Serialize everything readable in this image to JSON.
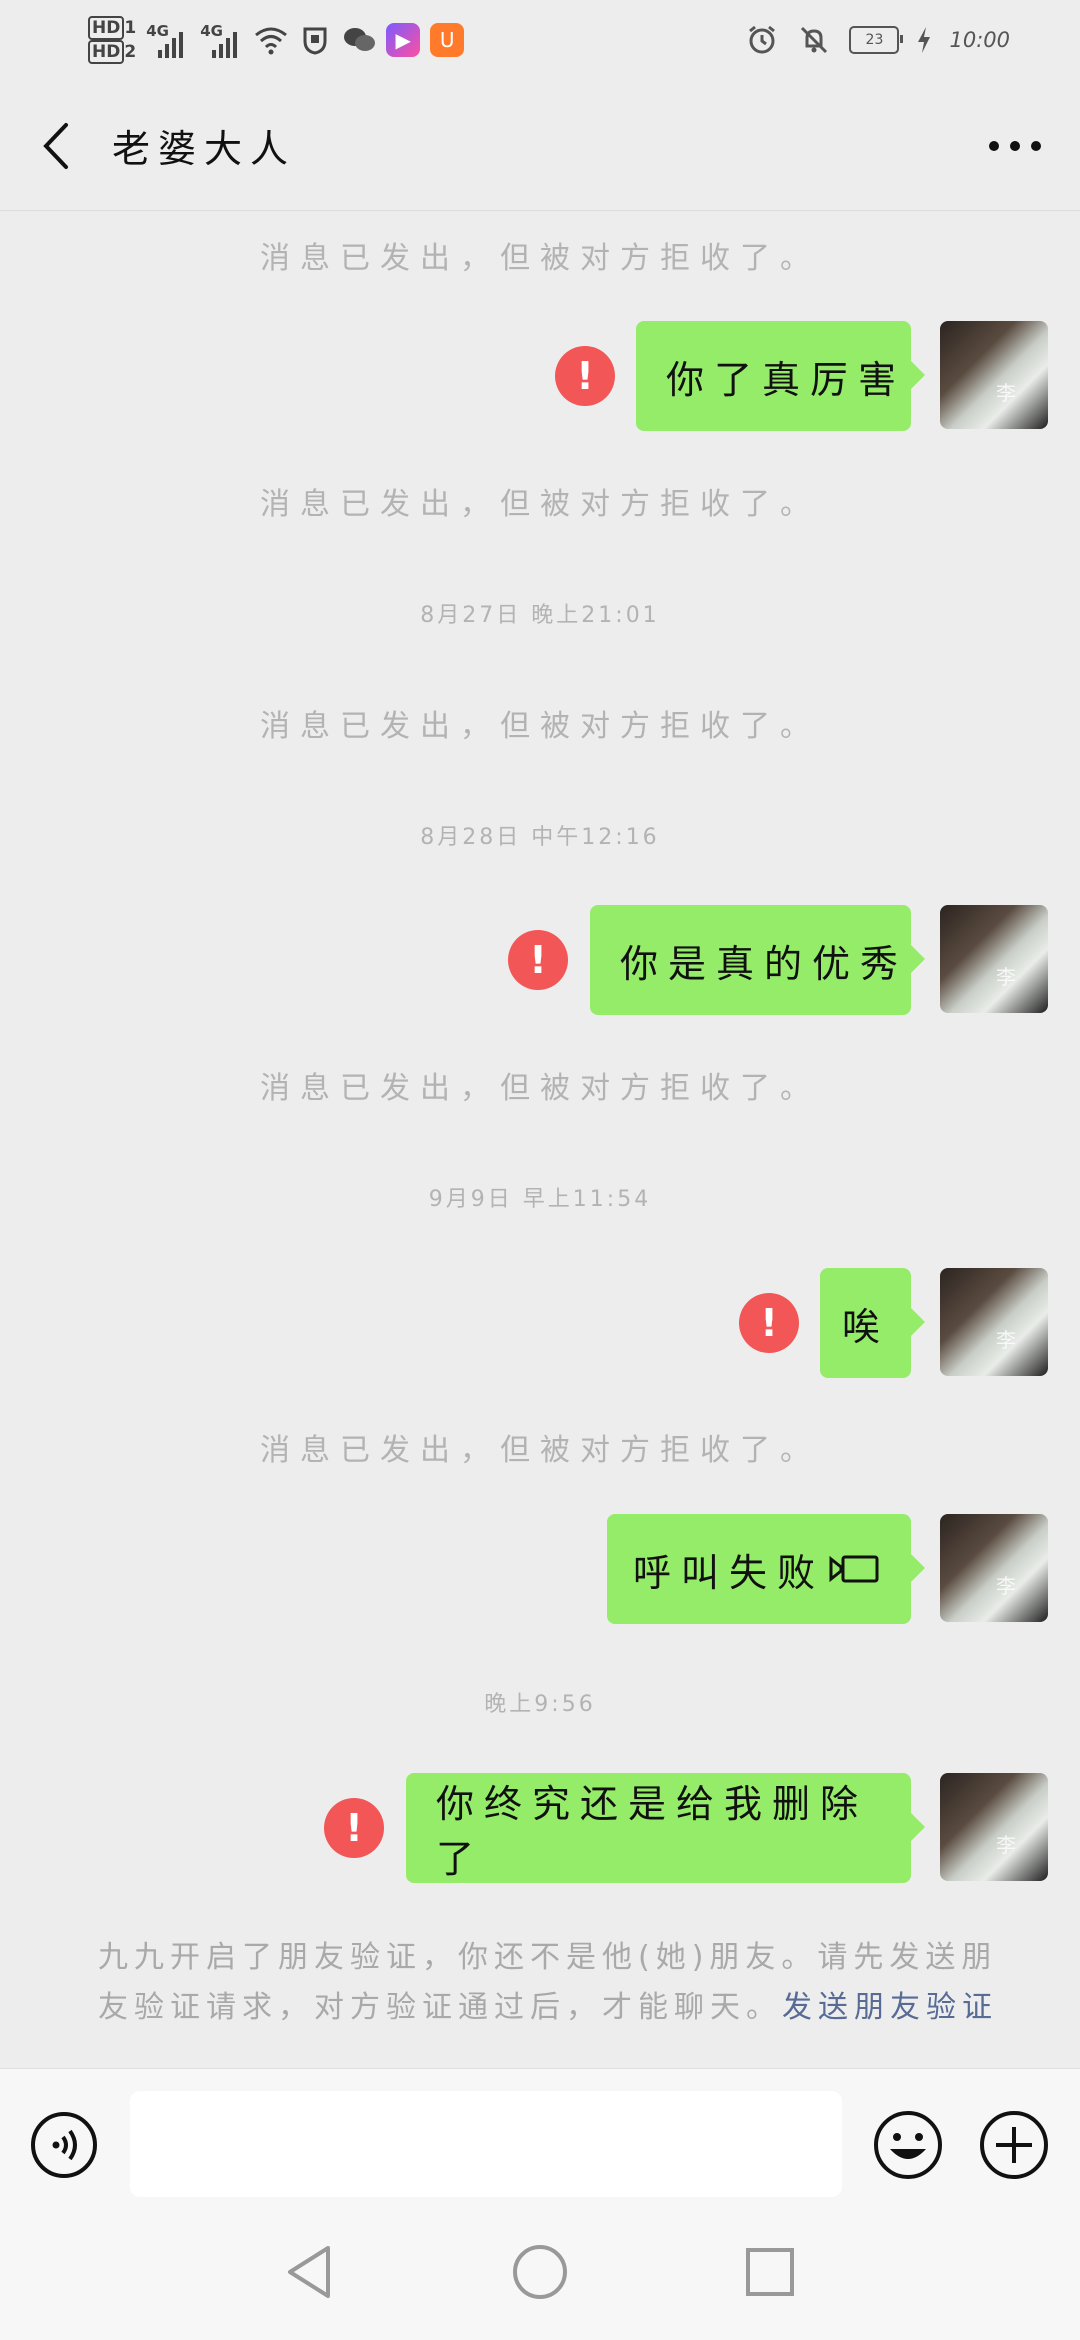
{
  "status_bar": {
    "hd1": "HD",
    "hd1_sub": "1",
    "hd2": "HD",
    "hd2_sub": "2",
    "net1": "4G",
    "net2": "4G",
    "battery": "23",
    "time": "10:00"
  },
  "header": {
    "title": "老婆大人"
  },
  "chat": {
    "items": [
      {
        "type": "system",
        "text": "消息已发出，但被对方拒收了。"
      },
      {
        "type": "message",
        "text": "你了真厉害",
        "failed": true
      },
      {
        "type": "system",
        "text": "消息已发出，但被对方拒收了。"
      },
      {
        "type": "time",
        "text": "8月27日 晚上21:01"
      },
      {
        "type": "system",
        "text": "消息已发出，但被对方拒收了。"
      },
      {
        "type": "time",
        "text": "8月28日 中午12:16"
      },
      {
        "type": "message",
        "text": "你是真的优秀",
        "failed": true
      },
      {
        "type": "system",
        "text": "消息已发出，但被对方拒收了。"
      },
      {
        "type": "time",
        "text": "9月9日 早上11:54"
      },
      {
        "type": "message",
        "text": "唉",
        "failed": true
      },
      {
        "type": "system",
        "text": "消息已发出，但被对方拒收了。"
      },
      {
        "type": "call",
        "text": "呼叫失败"
      },
      {
        "type": "time",
        "text": "晚上9:56"
      },
      {
        "type": "message",
        "text": "你终究还是给我删除了",
        "failed": true
      }
    ],
    "avatar_mark": "李",
    "failed_mark": "!",
    "notice": {
      "text": "九九开启了朋友验证，你还不是他(她)朋友。请先发送朋友验证请求，对方验证通过后，才能聊天。",
      "link": "发送朋友验证"
    }
  },
  "input": {
    "value": "",
    "placeholder": ""
  },
  "icons": {
    "back": "chevron-left-icon",
    "more": "more-dots-icon",
    "voice": "voice-icon",
    "emoji": "emoji-icon",
    "plus": "plus-icon",
    "call": "video-camera-icon",
    "nav_back": "triangle-back-icon",
    "nav_home": "circle-home-icon",
    "nav_recent": "square-recent-icon"
  },
  "colors": {
    "bubble": "#95ec69",
    "error": "#f25656",
    "link": "#576b95",
    "background": "#ededed"
  }
}
